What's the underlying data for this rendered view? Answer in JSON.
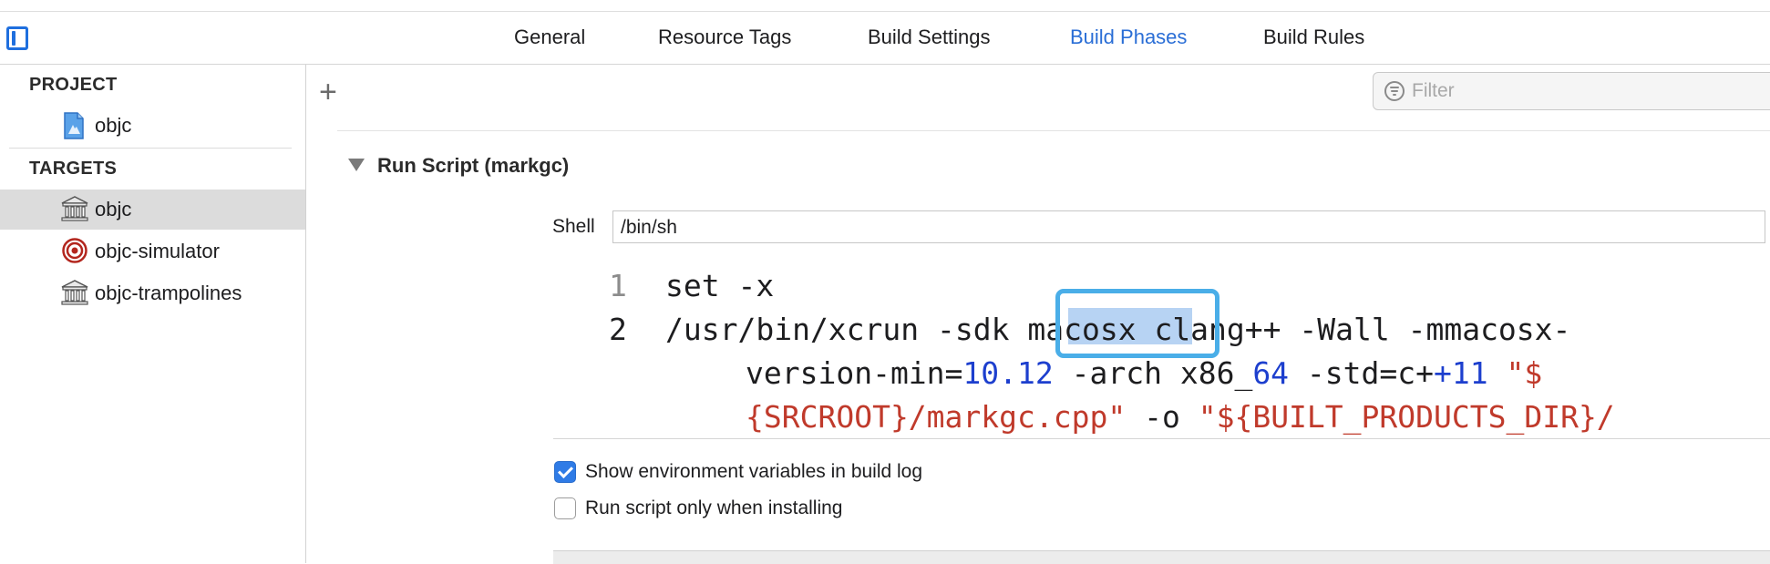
{
  "tabs": [
    {
      "label": "General"
    },
    {
      "label": "Resource Tags"
    },
    {
      "label": "Build Settings"
    },
    {
      "label": "Build Phases",
      "active": true
    },
    {
      "label": "Build Rules"
    }
  ],
  "sidebar": {
    "project_header": "PROJECT",
    "project_items": [
      {
        "label": "objc",
        "icon": "project-file-icon"
      }
    ],
    "targets_header": "TARGETS",
    "target_items": [
      {
        "label": "objc",
        "icon": "framework-icon",
        "selected": true
      },
      {
        "label": "objc-simulator",
        "icon": "target-icon"
      },
      {
        "label": "objc-trampolines",
        "icon": "framework-icon"
      }
    ]
  },
  "toolbar": {
    "add_symbol": "+",
    "filter_placeholder": "Filter"
  },
  "phase": {
    "title": "Run Script (markgc)",
    "shell_label": "Shell",
    "shell_value": "/bin/sh",
    "code": {
      "line_numbers": [
        "1",
        "2"
      ],
      "l1": "set -x",
      "l2a": "/usr/bin/xcrun -sdk ",
      "l2_selected": "macosx",
      "l2b": " clang++ -Wall -mmacosx-",
      "l3a": "version-min=",
      "l3_num1": "10.12",
      "l3b": " -arch x86_",
      "l3_num2": "64",
      "l3c": " -std=c+",
      "l3_num3": "+11",
      "l3_str": " \"$",
      "l4_str1": "{SRCROOT}/markgc.cpp\"",
      "l4b": " -o ",
      "l4_str2": "\"${BUILT_PRODUCTS_DIR}/"
    },
    "options": [
      {
        "label": "Show environment variables in build log",
        "checked": true
      },
      {
        "label": "Run script only when installing",
        "checked": false
      }
    ]
  },
  "colors": {
    "accent": "#2a6ed6",
    "selection": "#b7d3f3",
    "focus_ring": "#4aaee8",
    "string": "#c03a2b",
    "number": "#1d3fce"
  }
}
